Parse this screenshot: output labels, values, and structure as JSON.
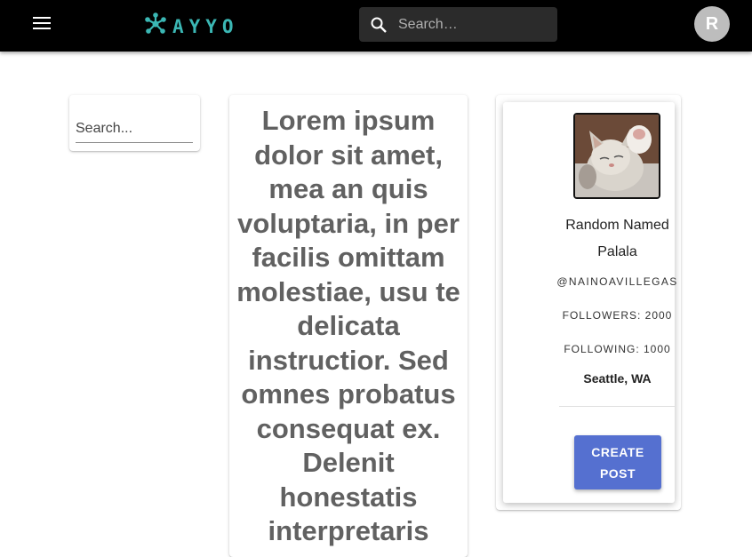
{
  "appbar": {
    "menu_icon": "menu-icon",
    "logo_icon": "molecule-logo-icon",
    "logo_text": "AYYO",
    "search_icon": "search-icon",
    "search_placeholder": "Search…",
    "avatar_initial": "R",
    "colors": {
      "background": "#000000",
      "logo": "#3bb7b4",
      "search_bg": "#2b2b2b",
      "avatar_bg": "#bdbdbd"
    }
  },
  "sidebar": {
    "search_placeholder": "Search..."
  },
  "post": {
    "text": "Lorem ipsum dolor sit amet, mea an quis voluptaria, in per facilis omittam molestiae, usu te delicata instructior. Sed omnes probatus consequat ex. Delenit honestatis interpretaris"
  },
  "profile": {
    "picture": "kitten-photo",
    "name": "Random Named Palala",
    "handle": "@NAINOAVILLEGAS",
    "followers": "FOLLOWERS: 2000",
    "following": "FOLLOWING: 1000",
    "location": "Seattle, WA",
    "create_post_label": "CREATE POST",
    "colors": {
      "button": "#5570d0"
    }
  }
}
